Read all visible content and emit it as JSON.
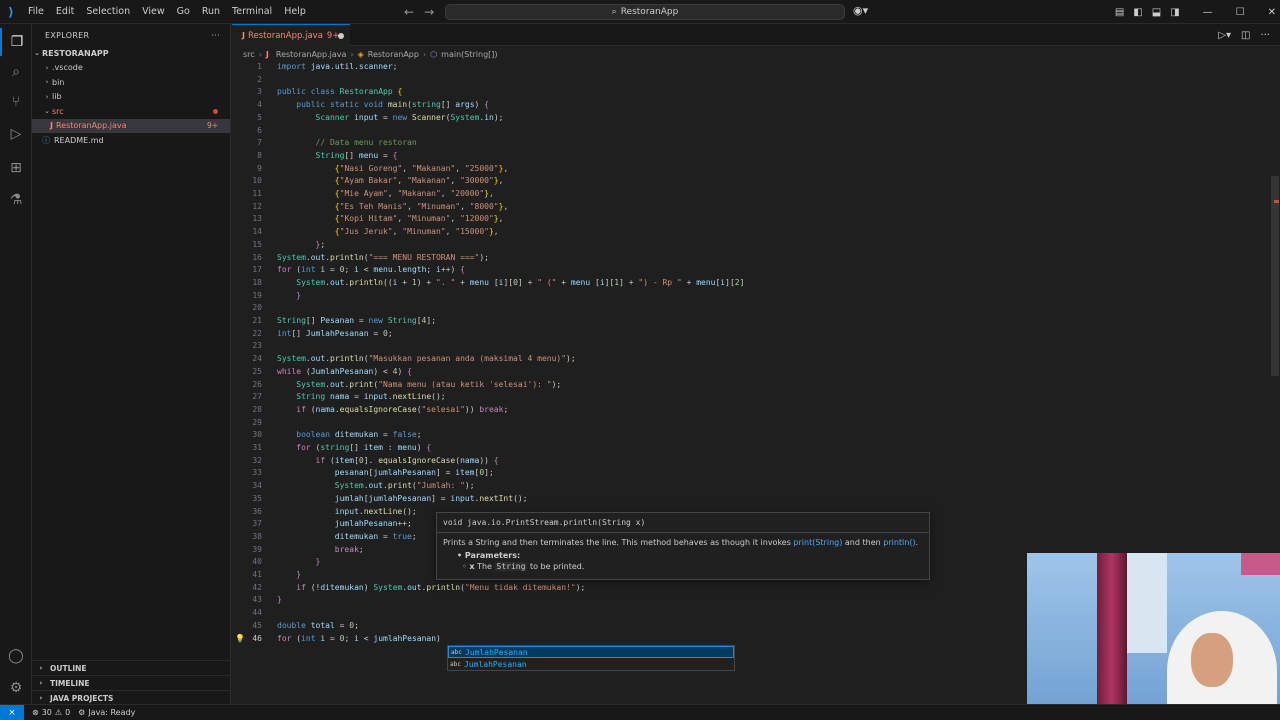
{
  "titlebar": {
    "menu": [
      "File",
      "Edit",
      "Selection",
      "View",
      "Go",
      "Run",
      "Terminal",
      "Help"
    ],
    "search_text": "RestoranApp"
  },
  "sidebar": {
    "title": "EXPLORER",
    "root": "RESTORANAPP",
    "items": [
      {
        "label": ".vscode"
      },
      {
        "label": "bin"
      },
      {
        "label": "lib"
      },
      {
        "label": "src"
      },
      {
        "label": "RestoranApp.java",
        "badge": "9+"
      },
      {
        "label": "README.md"
      }
    ],
    "outline": "OUTLINE",
    "timeline": "TIMELINE",
    "java_projects": "JAVA PROJECTS"
  },
  "editor": {
    "tab_label": "RestoranApp.java",
    "tab_badge": "9+",
    "breadcrumb": [
      "src",
      "RestoranApp.java",
      "RestoranApp",
      "main(String[])"
    ],
    "current_line": "46"
  },
  "hover": {
    "signature": "void java.io.PrintStream.println(String x)",
    "desc_prefix": "Prints a String and then terminates the line. This method behaves as though it invokes ",
    "link1": "print(String)",
    "desc_mid": " and then ",
    "link2": "println()",
    "desc_end": ".",
    "params_label": "Parameters:",
    "param_name": "x",
    "param_text_a": "The",
    "param_code": "String",
    "param_text_b": "to be printed."
  },
  "suggest": {
    "items": [
      "JumlahPesanan",
      "JumlahPesanan"
    ]
  },
  "status": {
    "errors": "30",
    "warnings": "0",
    "java": "Java: Ready"
  }
}
